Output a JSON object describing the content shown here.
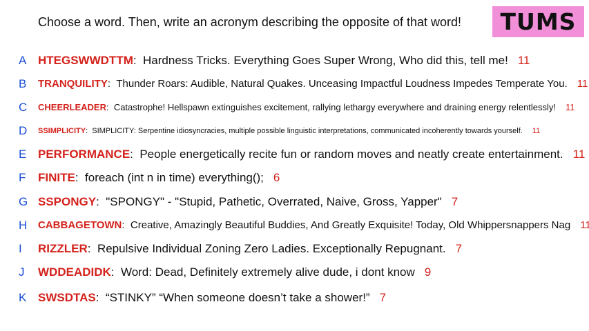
{
  "prompt": "Choose a word. Then, write an acronym describing the opposite of that word!",
  "team": {
    "name": "TUMS",
    "color": "#f28fd9"
  },
  "colors": {
    "letter": "#1a4fd6",
    "word": "#d4221c",
    "score": "#d4221c"
  },
  "entries": [
    {
      "letter": "A",
      "word": "HTEGSWWDTTM",
      "acronym": "Hardness Tricks. Everything Goes Super Wrong, Who did this, tell me!",
      "score": "11"
    },
    {
      "letter": "B",
      "word": "TRANQUILITY",
      "acronym": "Thunder Roars: Audible, Natural Quakes. Unceasing Impactful Loudness Impedes Temperate You.",
      "score": "11"
    },
    {
      "letter": "C",
      "word": "CHEERLEADER",
      "acronym": "Catastrophe! Hellspawn extinguishes excitement, rallying lethargy everywhere and draining energy relentlessly!",
      "score": "11"
    },
    {
      "letter": "D",
      "word": "SSIMPLICITY",
      "acronym": "SIMPLICITY: Serpentine idiosyncracies, multiple possible linguistic interpretations, communicated incoherently towards yourself.",
      "score": "11"
    },
    {
      "letter": "E",
      "word": "PERFORMANCE",
      "acronym": "People energetically recite fun or random moves and neatly create entertainment.",
      "score": "11"
    },
    {
      "letter": "F",
      "word": "FINITE",
      "acronym": "foreach (int n in time) everything();",
      "score": "6"
    },
    {
      "letter": "G",
      "word": "SSPONGY",
      "acronym": "\"SPONGY\" - \"Stupid, Pathetic, Overrated, Naive, Gross, Yapper\"",
      "score": "7"
    },
    {
      "letter": "H",
      "word": "CABBAGETOWN",
      "acronym": "Creative, Amazingly Beautiful Buddies, And Greatly Exquisite! Today, Old Whippersnappers Nag",
      "score": "11"
    },
    {
      "letter": "I",
      "word": "RIZZLER",
      "acronym": "Repulsive Individual Zoning Zero Ladies. Exceptionally Repugnant.",
      "score": "7"
    },
    {
      "letter": "J",
      "word": "WDDEADIDK",
      "acronym": "Word: Dead, Definitely extremely alive dude, i dont know",
      "score": "9"
    },
    {
      "letter": "K",
      "word": "SWSDTAS",
      "acronym": "“STINKY” “When someone doesn’t take a shower!”",
      "score": "7"
    }
  ]
}
